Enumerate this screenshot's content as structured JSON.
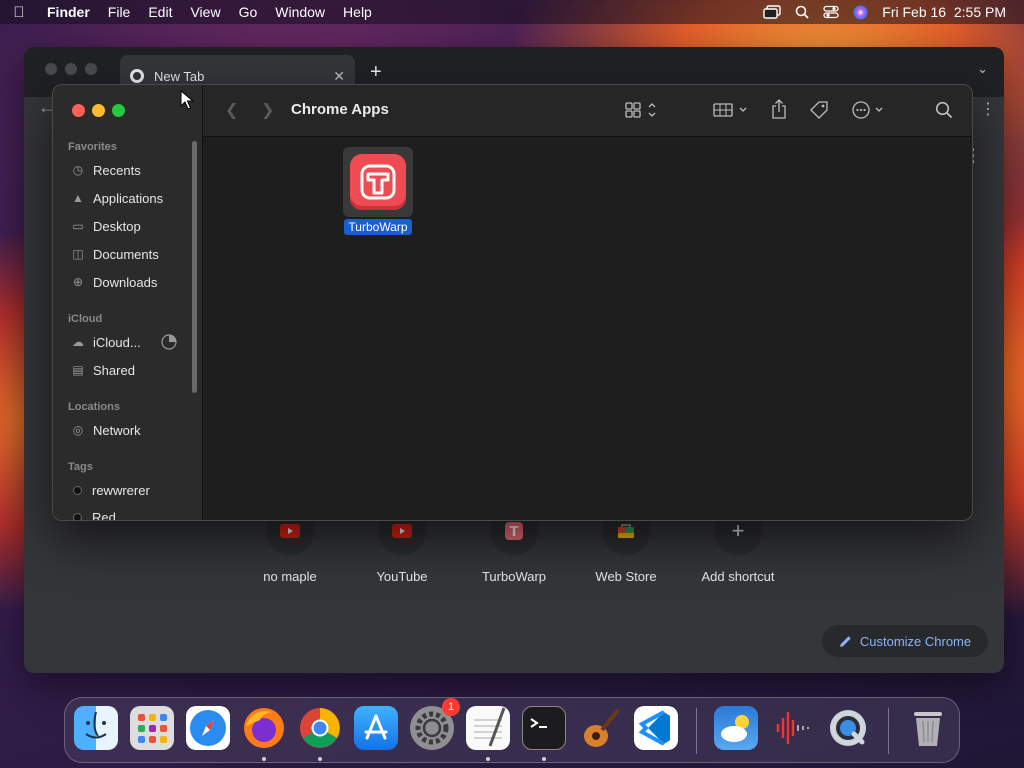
{
  "menubar": {
    "app_name": "Finder",
    "items": [
      "File",
      "Edit",
      "View",
      "Go",
      "Window",
      "Help"
    ],
    "clock": "Fri Feb 16  2:55 PM"
  },
  "chrome": {
    "tab_title": "New Tab",
    "shortcuts": [
      "no maple",
      "YouTube",
      "TurboWarp",
      "Web Store",
      "Add shortcut"
    ],
    "customize_label": "Customize Chrome"
  },
  "finder": {
    "title": "Chrome Apps",
    "sidebar": {
      "favorites_header": "Favorites",
      "favorites": [
        "Recents",
        "Applications",
        "Desktop",
        "Documents",
        "Downloads"
      ],
      "icloud_header": "iCloud",
      "icloud": [
        "iCloud...",
        "Shared"
      ],
      "locations_header": "Locations",
      "locations": [
        "Network"
      ],
      "tags_header": "Tags",
      "tags": [
        "rewwrerer",
        "Red"
      ]
    },
    "files": [
      {
        "name": "TurboWarp",
        "icon": "turbowarp-app-icon",
        "selected": true
      }
    ]
  },
  "dock": {
    "apps": [
      "Finder",
      "Launchpad",
      "Safari",
      "Firefox",
      "Google Chrome",
      "App Store",
      "System Settings",
      "TextEdit",
      "Terminal",
      "GarageBand",
      "Visual Studio Code",
      "Weather",
      "Voice Memos",
      "QuickTime Player",
      "Trash"
    ],
    "system_settings_badge": "1"
  }
}
